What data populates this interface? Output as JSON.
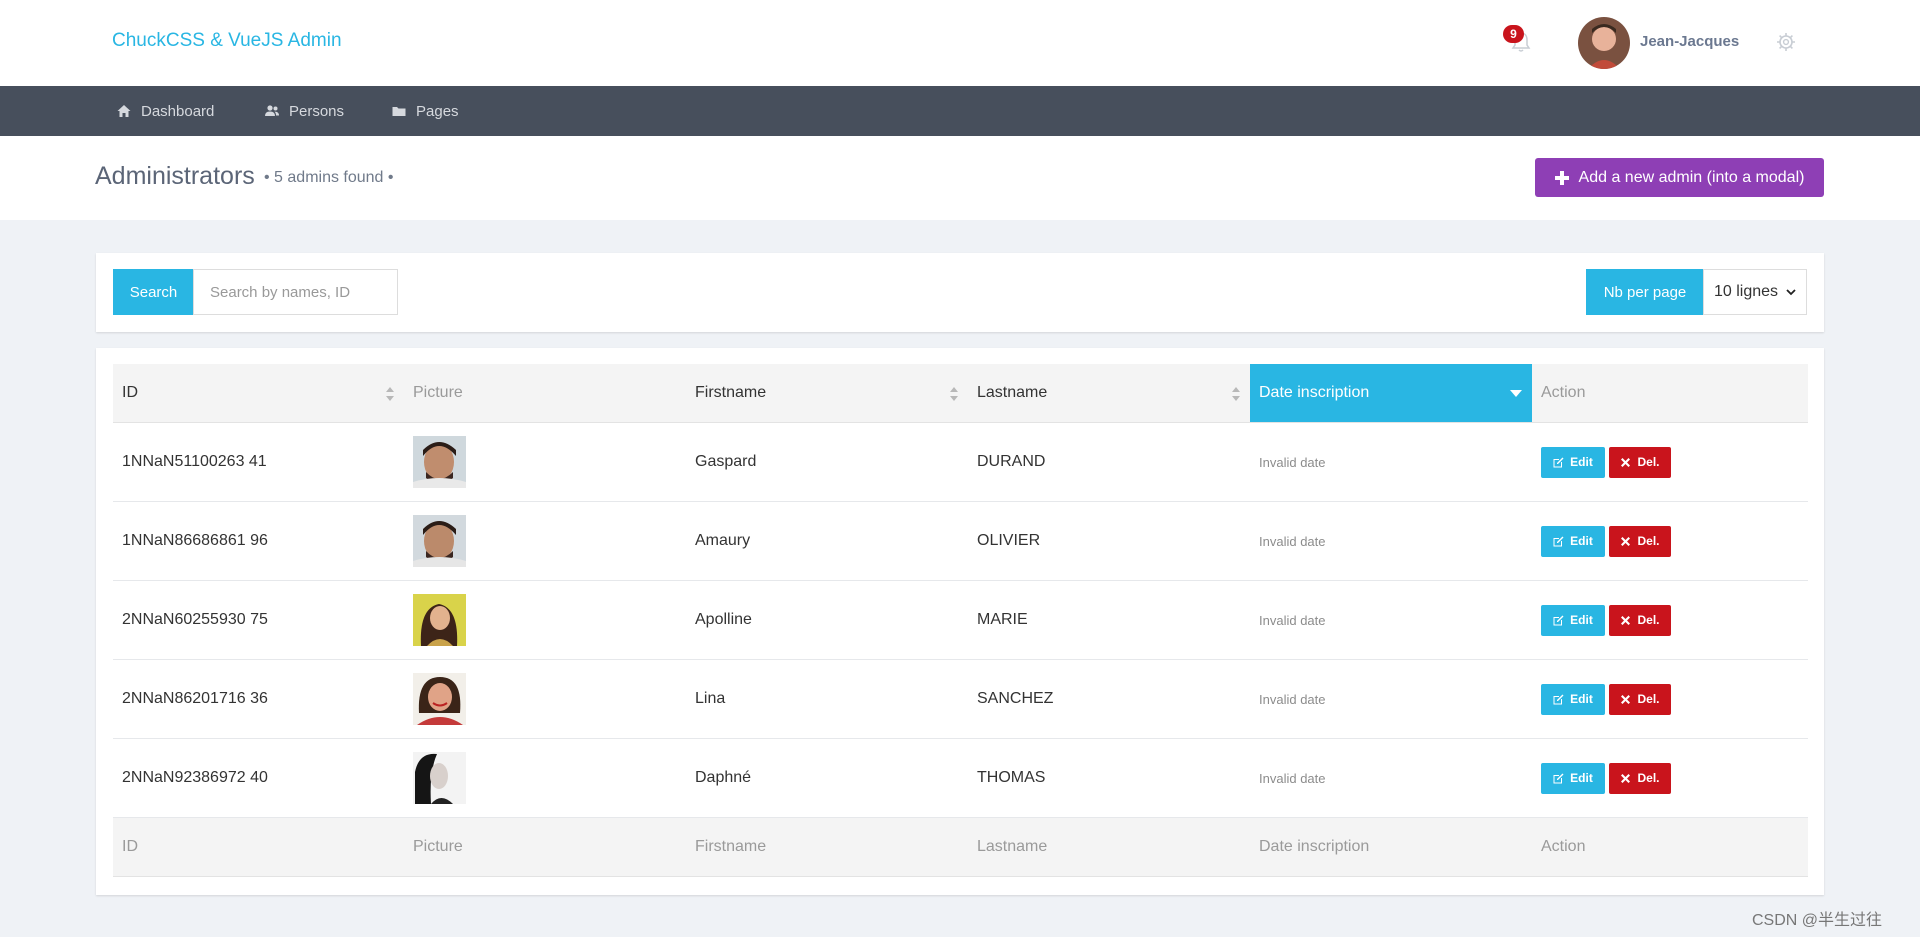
{
  "header": {
    "brand": "ChuckCSS & VueJS Admin",
    "notification_count": "9",
    "username": "Jean-Jacques"
  },
  "nav": {
    "items": [
      {
        "label": "Dashboard",
        "icon": "home-icon"
      },
      {
        "label": "Persons",
        "icon": "users-icon"
      },
      {
        "label": "Pages",
        "icon": "folder-icon"
      }
    ]
  },
  "page": {
    "title": "Administrators",
    "count_text": "• 5 admins found •",
    "add_button": "Add a new admin (into a modal)"
  },
  "search": {
    "button": "Search",
    "placeholder": "Search by names, ID",
    "per_page_label": "Nb per page",
    "per_page_value": "10 lignes"
  },
  "table": {
    "columns": [
      "ID",
      "Picture",
      "Firstname",
      "Lastname",
      "Date inscription",
      "Action"
    ],
    "sorted_column": "Date inscription",
    "rows": [
      {
        "id": "1NNaN51100263 41",
        "firstname": "Gaspard",
        "lastname": "DURAND",
        "date": "Invalid date",
        "avatar_color": "#6b4a3a"
      },
      {
        "id": "1NNaN86686861 96",
        "firstname": "Amaury",
        "lastname": "OLIVIER",
        "date": "Invalid date",
        "avatar_color": "#5e4638"
      },
      {
        "id": "2NNaN60255930 75",
        "firstname": "Apolline",
        "lastname": "MARIE",
        "date": "Invalid date",
        "avatar_color": "#8a6a2a"
      },
      {
        "id": "2NNaN86201716 36",
        "firstname": "Lina",
        "lastname": "SANCHEZ",
        "date": "Invalid date",
        "avatar_color": "#a04040"
      },
      {
        "id": "2NNaN92386972 40",
        "firstname": "Daphné",
        "lastname": "THOMAS",
        "date": "Invalid date",
        "avatar_color": "#2a2a2a"
      }
    ],
    "edit_label": "Edit",
    "del_label": "Del."
  },
  "watermark": "CSDN @半生过往",
  "colors": {
    "accent": "#29b6e3",
    "purple": "#8e3fb5",
    "danger": "#c9141c",
    "navbar": "#474f5c"
  }
}
